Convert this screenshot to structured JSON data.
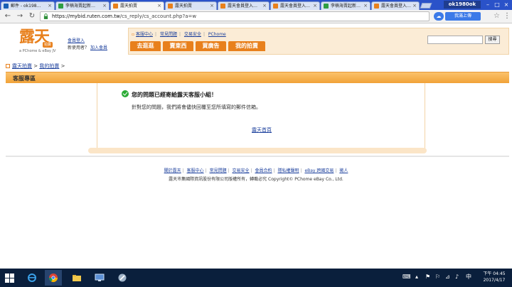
{
  "browser": {
    "tabs": [
      {
        "title": "郵件 - ok198…",
        "favicon_color": "#1a5fb4",
        "active": false
      },
      {
        "title": "李楠海賣起新…",
        "favicon_color": "#2f9e44",
        "active": false
      },
      {
        "title": "露天拍賣",
        "favicon_color": "#e8801c",
        "active": true
      },
      {
        "title": "露天拍賣",
        "favicon_color": "#e8801c",
        "active": false
      },
      {
        "title": "露天會員登入…",
        "favicon_color": "#e8801c",
        "active": false
      },
      {
        "title": "露天會員登入…",
        "favicon_color": "#e8801c",
        "active": false
      },
      {
        "title": "李楠海賣起新…",
        "favicon_color": "#2f9e44",
        "active": false
      },
      {
        "title": "露天會員登入…",
        "favicon_color": "#e8801c",
        "active": false
      }
    ],
    "profile_name": "ok1980ok",
    "url_host": "https://mybid.ruten.com.tw",
    "url_path": "/cs_reply/cs_account.php?a=w",
    "extension_label": "我滿上傳"
  },
  "site": {
    "logo_text": "露天",
    "logo_badge": "拍賣",
    "logo_sub": "a PChome & eBay JV",
    "member_login": "會員登入",
    "new_user_prompt": "新使用者？",
    "join_member": "加入會員",
    "top_links": [
      "客服中心",
      "常見問題",
      "交易安全",
      "PChome"
    ],
    "nav_tabs": [
      "去逛逛",
      "賣東西",
      "買廣告",
      "我的拍賣"
    ],
    "search_button": "搜尋",
    "breadcrumb": {
      "home": "露天拍賣",
      "sep": ">",
      "current": "我的拍賣"
    },
    "section_title": "客服專區",
    "message_title": "您的問題已經寄給露天客服小組！",
    "message_body": "針對您的問題，我們將會儘快回覆至您所填寫的郵件信箱。",
    "home_link": "露天首頁",
    "footer_links": [
      "關於露天",
      "客服中心",
      "常見問題",
      "交易安全",
      "會員合約",
      "隱私權聲明",
      "eBay 跨國交易",
      "徵人"
    ],
    "copyright": "露天市集國際資訊股份有限公司版權所有，轉載必究 Copyright©  PChome eBay Co., Ltd."
  },
  "taskbar": {
    "time": "下午 04:45",
    "date": "2017/4/17",
    "ime": "中"
  },
  "colors": {
    "accent": "#e8801c",
    "link": "#1b3f9c",
    "section_bar": "#f1a238",
    "tab_strip": "#2a52c9",
    "taskbar": "#0a1f3c"
  }
}
